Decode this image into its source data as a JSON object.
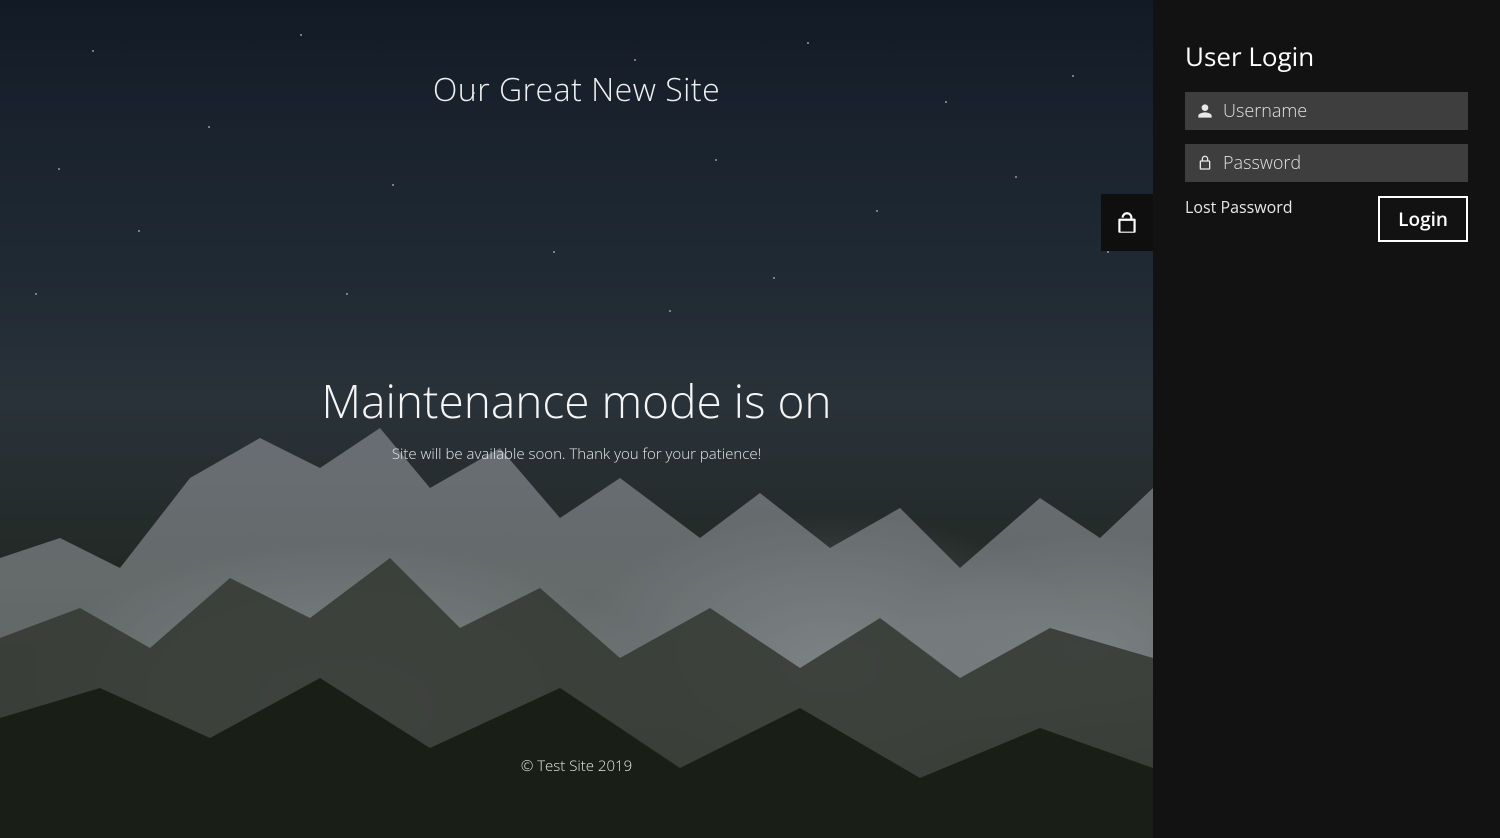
{
  "site": {
    "title": "Our Great New Site"
  },
  "maintenance": {
    "heading": "Maintenance mode is on",
    "subtext": "Site will be available soon. Thank you for your patience!"
  },
  "footer": {
    "text": "© Test Site 2019"
  },
  "login": {
    "title": "User Login",
    "username_placeholder": "Username",
    "password_placeholder": "Password",
    "lost_password": "Lost Password",
    "button": "Login"
  },
  "icons": {
    "unlock": "unlock-icon",
    "user": "user-icon",
    "lock": "lock-icon"
  }
}
